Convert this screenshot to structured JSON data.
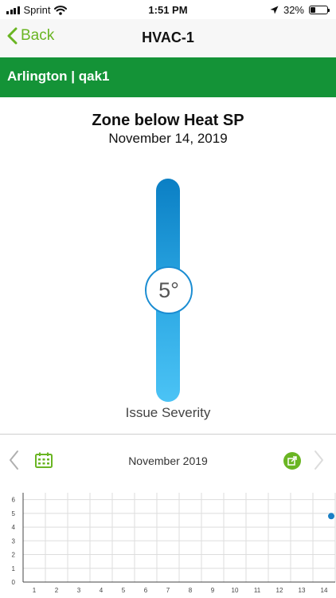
{
  "status_bar": {
    "carrier": "Sprint",
    "time": "1:51 PM",
    "battery": "32%",
    "battery_level": 0.32
  },
  "nav": {
    "back_label": "Back",
    "title": "HVAC-1"
  },
  "location": {
    "label": "Arlington | qak1"
  },
  "issue": {
    "title": "Zone below Heat SP",
    "date": "November 14, 2019",
    "severity_value": "5°",
    "severity_label": "Issue Severity"
  },
  "chart_toolbar": {
    "month": "November 2019",
    "icons": [
      "chevron-left-icon",
      "calendar-icon",
      "share-icon",
      "chevron-right-icon"
    ]
  },
  "chart_data": {
    "type": "scatter",
    "x_ticks": [
      1,
      2,
      3,
      4,
      5,
      6,
      7,
      8,
      9,
      10,
      11,
      12,
      13,
      14
    ],
    "y_ticks": [
      0,
      1,
      2,
      3,
      4,
      5,
      6
    ],
    "xlim": [
      0.5,
      14.5
    ],
    "ylim": [
      0,
      6.5
    ],
    "points": [
      {
        "x": 14.5,
        "y": 4.8
      }
    ],
    "grid": true,
    "point_color": "#1a7fc4"
  }
}
